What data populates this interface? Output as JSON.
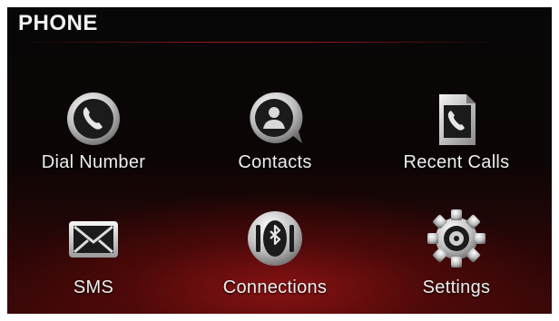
{
  "header": {
    "title": "PHONE"
  },
  "menu": {
    "items": [
      {
        "label": "Dial Number",
        "icon": "phone-handset-icon"
      },
      {
        "label": "Contacts",
        "icon": "contacts-person-icon"
      },
      {
        "label": "Recent Calls",
        "icon": "recent-calls-icon"
      },
      {
        "label": "SMS",
        "icon": "envelope-icon"
      },
      {
        "label": "Connections",
        "icon": "bluetooth-icon"
      },
      {
        "label": "Settings",
        "icon": "gear-icon"
      }
    ]
  },
  "colors": {
    "background": "#0a0505",
    "accent": "#9a1414",
    "text": "#eeeeee",
    "icon_silver": "#d8d8d8",
    "icon_dark": "#1a1a1a"
  }
}
